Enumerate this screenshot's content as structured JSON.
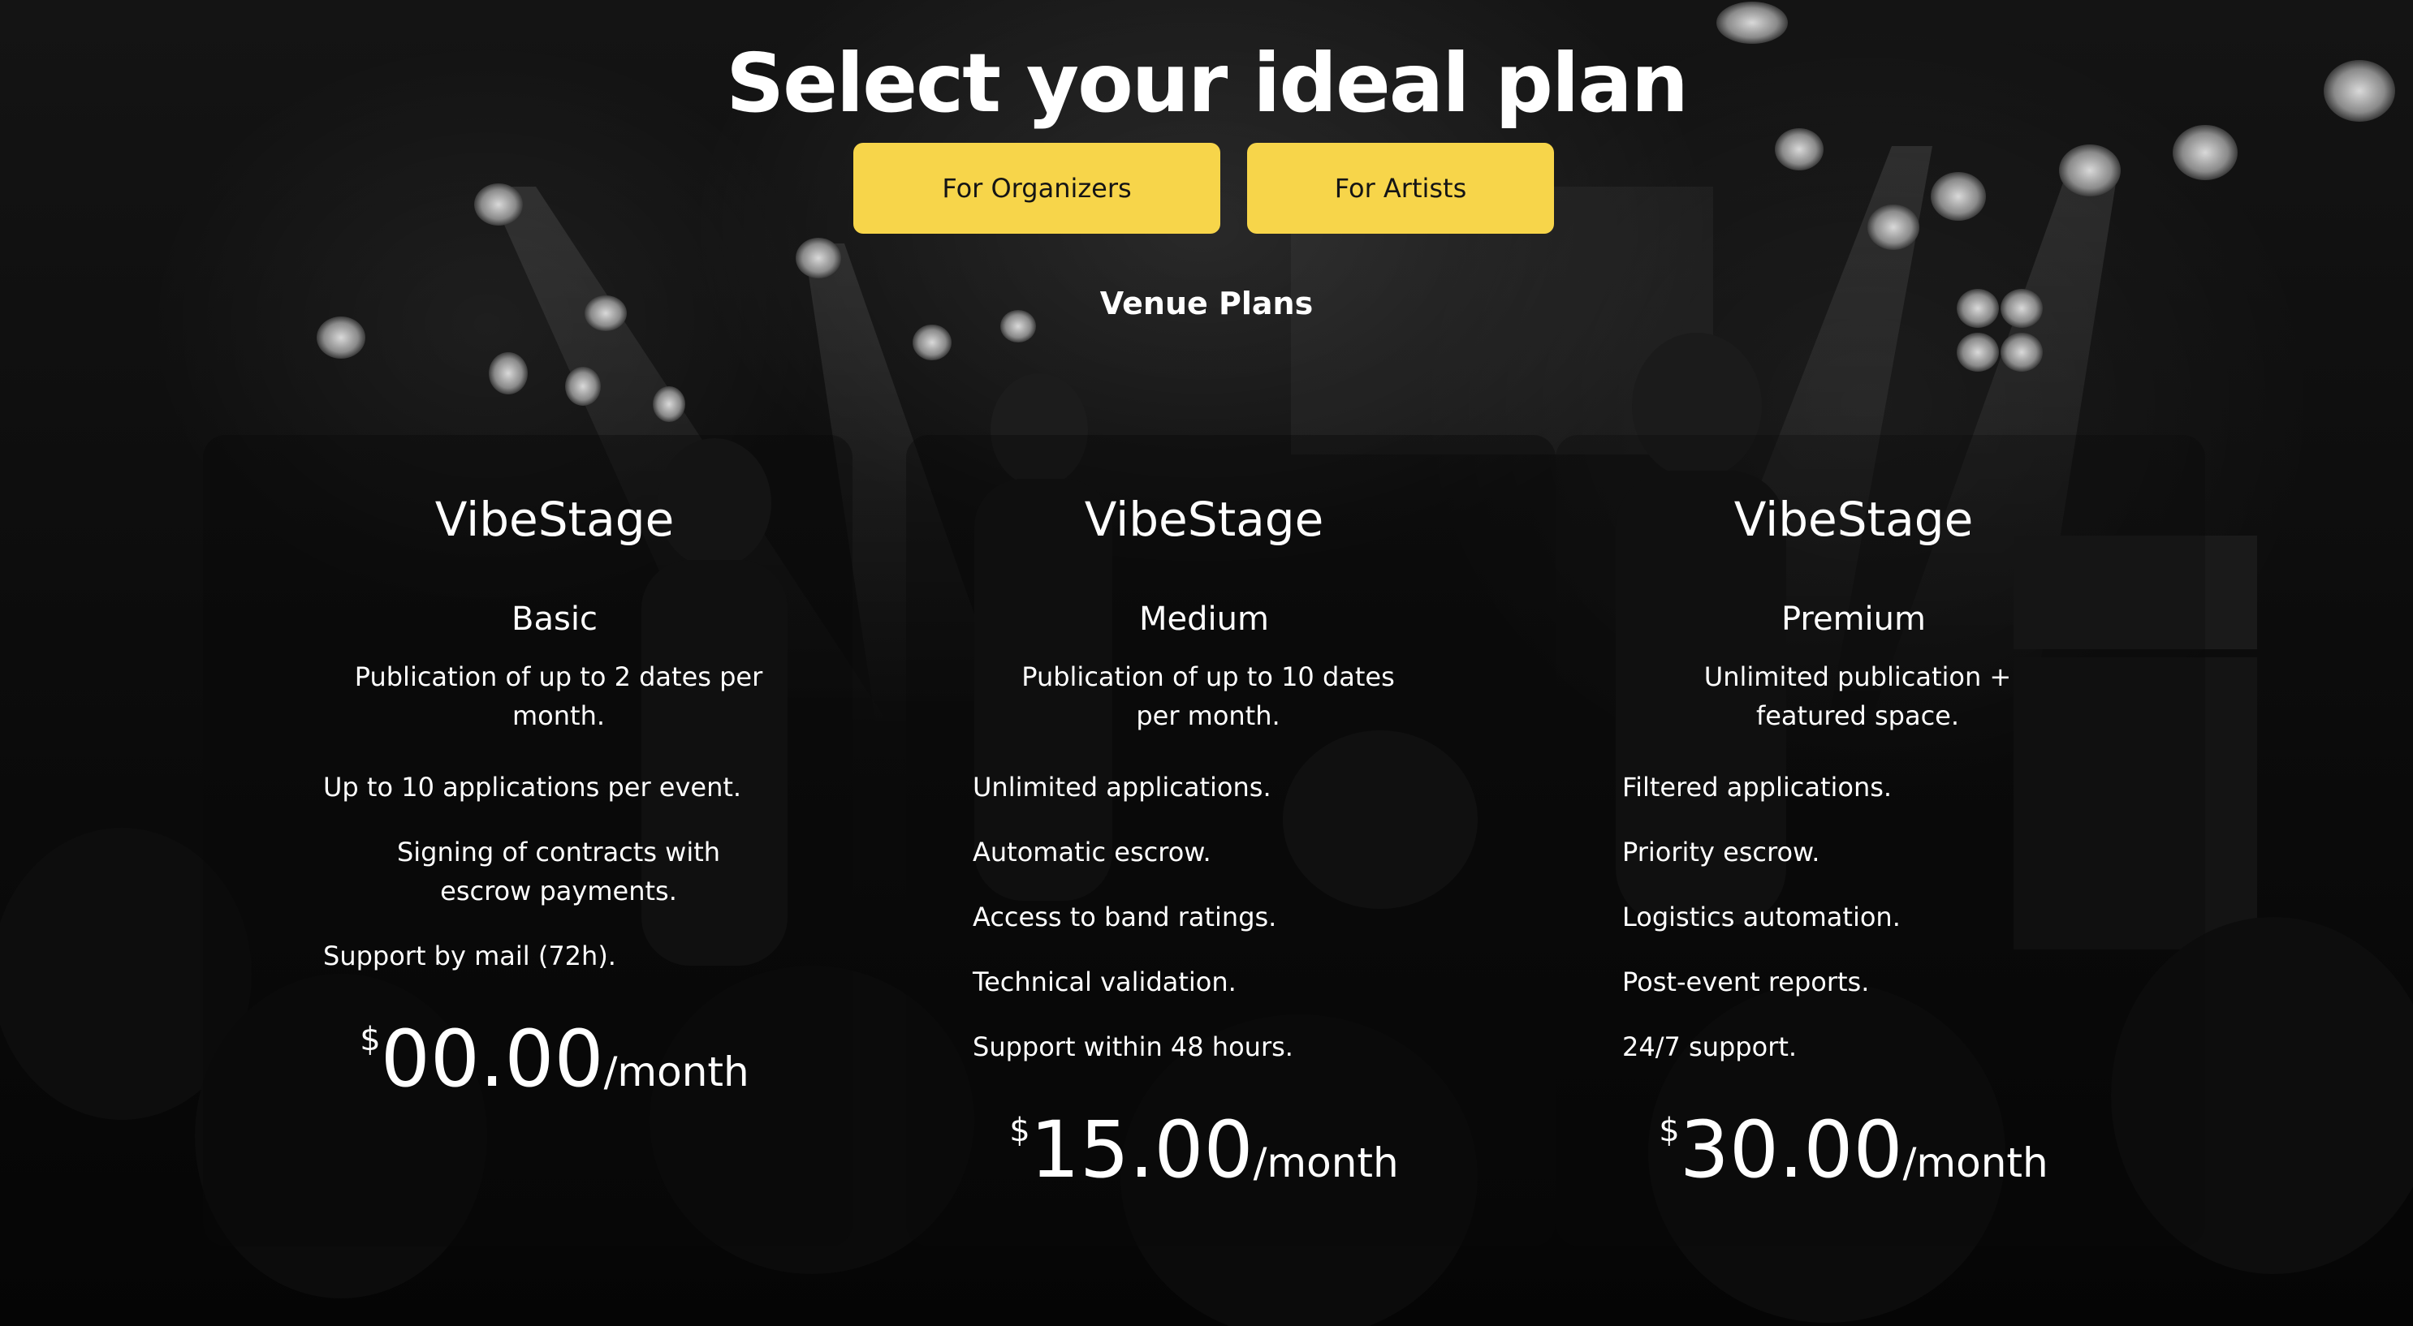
{
  "header": {
    "title": "Select your ideal plan",
    "subtitle": "Venue Plans"
  },
  "tabs": [
    {
      "label": "For Organizers"
    },
    {
      "label": "For Artists"
    }
  ],
  "colors": {
    "accent": "#f7d54a",
    "background": "#080808",
    "text": "#ffffff"
  },
  "plans": [
    {
      "brand": "VibeStage",
      "tier": "Basic",
      "lead": "Publication of up to 2 dates per month.",
      "features": [
        "Up to 10 applications per event.",
        "Signing of contracts with escrow payments.",
        "Support by mail (72h)."
      ],
      "currency": "$",
      "amount": "00.00",
      "period": "/month"
    },
    {
      "brand": "VibeStage",
      "tier": "Medium",
      "lead": "Publication of up to 10 dates per month.",
      "features": [
        "Unlimited applications.",
        "Automatic escrow.",
        "Access to band ratings.",
        "Technical validation.",
        "Support within 48 hours."
      ],
      "currency": "$",
      "amount": "15.00",
      "period": "/month"
    },
    {
      "brand": "VibeStage",
      "tier": "Premium",
      "lead": "Unlimited publication + featured space.",
      "features": [
        "Filtered applications.",
        "Priority escrow.",
        "Logistics automation.",
        "Post-event reports.",
        "24/7 support."
      ],
      "currency": "$",
      "amount": "30.00",
      "period": "/month"
    }
  ]
}
